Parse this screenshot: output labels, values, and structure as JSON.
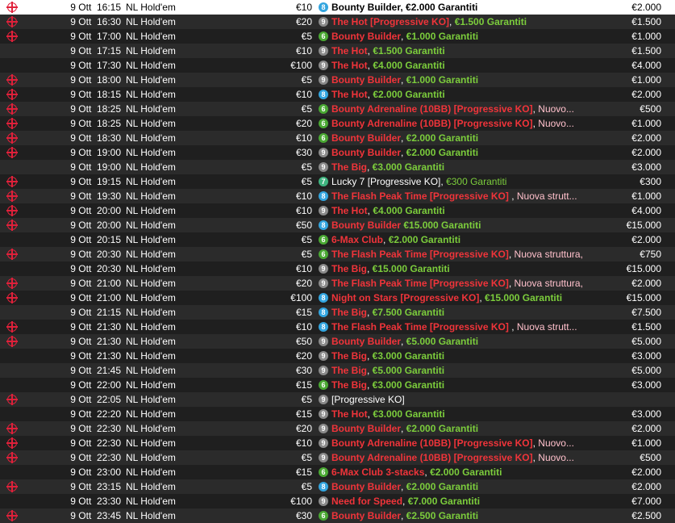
{
  "colors": {
    "badge_8": "#33a5df",
    "badge_9": "#8a8a8a",
    "badge_6": "#4aa833",
    "badge_7": "#3fb37f",
    "row_dark": "#2b2b2b",
    "row_darker": "#1f1f1f",
    "red_text": "#f0343a",
    "green_text": "#7ccd3c",
    "selected_row": "#ffffff"
  },
  "rows": [
    {
      "target": true,
      "date": "9 Ott",
      "time": "16:15",
      "game": "NL Hold'em",
      "buyin": "€10",
      "badge": "8",
      "parts": [
        {
          "t": "Bounty Builder, ",
          "c": "black-b"
        },
        {
          "t": "€2.000 Garantiti",
          "c": "black-b"
        }
      ],
      "prize": "€2.000",
      "selected": true
    },
    {
      "target": true,
      "date": "9 Ott",
      "time": "16:30",
      "game": "NL Hold'em",
      "buyin": "€20",
      "badge": "9",
      "parts": [
        {
          "t": "The Hot [Progressive KO]",
          "c": "red"
        },
        {
          "t": ", ",
          "c": "white"
        },
        {
          "t": "€1.500 Garantiti",
          "c": "green"
        }
      ],
      "prize": "€1.500"
    },
    {
      "target": true,
      "date": "9 Ott",
      "time": "17:00",
      "game": "NL Hold'em",
      "buyin": "€5",
      "badge": "6",
      "parts": [
        {
          "t": "Bounty Builder",
          "c": "red"
        },
        {
          "t": ", ",
          "c": "white"
        },
        {
          "t": "€1.000 Garantiti",
          "c": "green"
        }
      ],
      "prize": "€1.000"
    },
    {
      "target": false,
      "date": "9 Ott",
      "time": "17:15",
      "game": "NL Hold'em",
      "buyin": "€10",
      "badge": "9",
      "parts": [
        {
          "t": "The Hot",
          "c": "red"
        },
        {
          "t": ", ",
          "c": "white"
        },
        {
          "t": "€1.500 Garantiti",
          "c": "green"
        }
      ],
      "prize": "€1.500"
    },
    {
      "target": false,
      "date": "9 Ott",
      "time": "17:30",
      "game": "NL Hold'em",
      "buyin": "€100",
      "badge": "9",
      "parts": [
        {
          "t": "The Hot",
          "c": "red"
        },
        {
          "t": ", ",
          "c": "white"
        },
        {
          "t": "€4.000 Garantiti",
          "c": "green"
        }
      ],
      "prize": "€4.000"
    },
    {
      "target": true,
      "date": "9 Ott",
      "time": "18:00",
      "game": "NL Hold'em",
      "buyin": "€5",
      "badge": "9",
      "parts": [
        {
          "t": "Bounty Builder",
          "c": "red"
        },
        {
          "t": ", ",
          "c": "white"
        },
        {
          "t": "€1.000 Garantiti",
          "c": "green"
        }
      ],
      "prize": "€1.000"
    },
    {
      "target": true,
      "date": "9 Ott",
      "time": "18:15",
      "game": "NL Hold'em",
      "buyin": "€10",
      "badge": "8",
      "parts": [
        {
          "t": "The Hot",
          "c": "red"
        },
        {
          "t": ", ",
          "c": "white"
        },
        {
          "t": "€2.000 Garantiti",
          "c": "green"
        }
      ],
      "prize": "€2.000"
    },
    {
      "target": true,
      "date": "9 Ott",
      "time": "18:25",
      "game": "NL Hold'em",
      "buyin": "€5",
      "badge": "6",
      "parts": [
        {
          "t": "Bounty Adrenaline (10BB) [Progressive KO]",
          "c": "red"
        },
        {
          "t": ", ",
          "c": "white"
        },
        {
          "t": "Nuovo...",
          "c": "pink"
        }
      ],
      "prize": "€500"
    },
    {
      "target": true,
      "date": "9 Ott",
      "time": "18:25",
      "game": "NL Hold'em",
      "buyin": "€20",
      "badge": "6",
      "parts": [
        {
          "t": "Bounty Adrenaline (10BB) [Progressive KO]",
          "c": "red"
        },
        {
          "t": ", ",
          "c": "white"
        },
        {
          "t": "Nuovo...",
          "c": "pink"
        }
      ],
      "prize": "€1.000"
    },
    {
      "target": true,
      "date": "9 Ott",
      "time": "18:30",
      "game": "NL Hold'em",
      "buyin": "€10",
      "badge": "6",
      "parts": [
        {
          "t": "Bounty Builder",
          "c": "red"
        },
        {
          "t": ", ",
          "c": "white"
        },
        {
          "t": "€2.000 Garantiti",
          "c": "green"
        }
      ],
      "prize": "€2.000"
    },
    {
      "target": true,
      "date": "9 Ott",
      "time": "19:00",
      "game": "NL Hold'em",
      "buyin": "€30",
      "badge": "9",
      "parts": [
        {
          "t": "Bounty Builder",
          "c": "red"
        },
        {
          "t": ", ",
          "c": "white"
        },
        {
          "t": "€2.000 Garantiti",
          "c": "green"
        }
      ],
      "prize": "€2.000"
    },
    {
      "target": false,
      "date": "9 Ott",
      "time": "19:00",
      "game": "NL Hold'em",
      "buyin": "€5",
      "badge": "9",
      "parts": [
        {
          "t": "The Big",
          "c": "red"
        },
        {
          "t": ", ",
          "c": "white"
        },
        {
          "t": "€3.000 Garantiti",
          "c": "green"
        }
      ],
      "prize": "€3.000"
    },
    {
      "target": true,
      "date": "9 Ott",
      "time": "19:15",
      "game": "NL Hold'em",
      "buyin": "€5",
      "badge": "7",
      "parts": [
        {
          "t": "Lucky 7 [Progressive KO], ",
          "c": "white"
        },
        {
          "t": "€300 Garantiti",
          "c": "green-lite"
        }
      ],
      "prize": "€300"
    },
    {
      "target": true,
      "date": "9 Ott",
      "time": "19:30",
      "game": "NL Hold'em",
      "buyin": "€10",
      "badge": "8",
      "parts": [
        {
          "t": "The Flash Peak Time [Progressive KO]",
          "c": "red"
        },
        {
          "t": " , ",
          "c": "white"
        },
        {
          "t": "Nuova strutt...",
          "c": "pink"
        }
      ],
      "prize": "€1.000"
    },
    {
      "target": true,
      "date": "9 Ott",
      "time": "20:00",
      "game": "NL Hold'em",
      "buyin": "€10",
      "badge": "9",
      "parts": [
        {
          "t": "The Hot",
          "c": "red"
        },
        {
          "t": ", ",
          "c": "white"
        },
        {
          "t": "€4.000 Garantiti",
          "c": "green"
        }
      ],
      "prize": "€4.000"
    },
    {
      "target": true,
      "date": "9 Ott",
      "time": "20:00",
      "game": "NL Hold'em",
      "buyin": "€50",
      "badge": "8",
      "parts": [
        {
          "t": "Bounty Builder",
          "c": "red"
        },
        {
          "t": " ",
          "c": "white"
        },
        {
          "t": "€15.000 Garantiti",
          "c": "green"
        }
      ],
      "prize": "€15.000"
    },
    {
      "target": false,
      "date": "9 Ott",
      "time": "20:15",
      "game": "NL Hold'em",
      "buyin": "€5",
      "badge": "6",
      "parts": [
        {
          "t": "6-Max Club",
          "c": "red"
        },
        {
          "t": ", ",
          "c": "white"
        },
        {
          "t": "€2.000 Garantiti",
          "c": "green"
        }
      ],
      "prize": "€2.000"
    },
    {
      "target": true,
      "date": "9 Ott",
      "time": "20:30",
      "game": "NL Hold'em",
      "buyin": "€5",
      "badge": "6",
      "parts": [
        {
          "t": "The Flash Peak Time [Progressive KO]",
          "c": "red"
        },
        {
          "t": ", ",
          "c": "white"
        },
        {
          "t": "Nuova struttura,",
          "c": "pink"
        }
      ],
      "prize": "€750"
    },
    {
      "target": false,
      "date": "9 Ott",
      "time": "20:30",
      "game": "NL Hold'em",
      "buyin": "€10",
      "badge": "9",
      "parts": [
        {
          "t": "The Big",
          "c": "red"
        },
        {
          "t": ", ",
          "c": "white"
        },
        {
          "t": "€15.000 Garantiti",
          "c": "green"
        }
      ],
      "prize": "€15.000"
    },
    {
      "target": true,
      "date": "9 Ott",
      "time": "21:00",
      "game": "NL Hold'em",
      "buyin": "€20",
      "badge": "9",
      "parts": [
        {
          "t": "The Flash Peak Time [Progressive KO]",
          "c": "red"
        },
        {
          "t": ", ",
          "c": "white"
        },
        {
          "t": "Nuova struttura,",
          "c": "pink"
        }
      ],
      "prize": "€2.000"
    },
    {
      "target": true,
      "date": "9 Ott",
      "time": "21:00",
      "game": "NL Hold'em",
      "buyin": "€100",
      "badge": "8",
      "parts": [
        {
          "t": "Night on Stars [Progressive KO]",
          "c": "red"
        },
        {
          "t": ", ",
          "c": "white"
        },
        {
          "t": "€15.000 Garantiti",
          "c": "green"
        }
      ],
      "prize": "€15.000"
    },
    {
      "target": false,
      "date": "9 Ott",
      "time": "21:15",
      "game": "NL Hold'em",
      "buyin": "€15",
      "badge": "8",
      "parts": [
        {
          "t": "The Big",
          "c": "red"
        },
        {
          "t": ", ",
          "c": "white"
        },
        {
          "t": "€7.500 Garantiti",
          "c": "green"
        }
      ],
      "prize": "€7.500"
    },
    {
      "target": true,
      "date": "9 Ott",
      "time": "21:30",
      "game": "NL Hold'em",
      "buyin": "€10",
      "badge": "8",
      "parts": [
        {
          "t": "The Flash Peak Time [Progressive KO]",
          "c": "red"
        },
        {
          "t": " , ",
          "c": "white"
        },
        {
          "t": "Nuova strutt...",
          "c": "pink"
        }
      ],
      "prize": "€1.500"
    },
    {
      "target": true,
      "date": "9 Ott",
      "time": "21:30",
      "game": "NL Hold'em",
      "buyin": "€50",
      "badge": "9",
      "parts": [
        {
          "t": "Bounty Builder",
          "c": "red"
        },
        {
          "t": ", ",
          "c": "white"
        },
        {
          "t": "€5.000 Garantiti",
          "c": "green"
        }
      ],
      "prize": "€5.000"
    },
    {
      "target": false,
      "date": "9 Ott",
      "time": "21:30",
      "game": "NL Hold'em",
      "buyin": "€20",
      "badge": "9",
      "parts": [
        {
          "t": "The Big",
          "c": "red"
        },
        {
          "t": ", ",
          "c": "white"
        },
        {
          "t": "€3.000 Garantiti",
          "c": "green"
        }
      ],
      "prize": "€3.000"
    },
    {
      "target": false,
      "date": "9 Ott",
      "time": "21:45",
      "game": "NL Hold'em",
      "buyin": "€30",
      "badge": "9",
      "parts": [
        {
          "t": "The Big",
          "c": "red"
        },
        {
          "t": ", ",
          "c": "white"
        },
        {
          "t": "€5.000 Garantiti",
          "c": "green"
        }
      ],
      "prize": "€5.000"
    },
    {
      "target": false,
      "date": "9 Ott",
      "time": "22:00",
      "game": "NL Hold'em",
      "buyin": "€15",
      "badge": "6",
      "parts": [
        {
          "t": "The Big",
          "c": "red"
        },
        {
          "t": ", ",
          "c": "white"
        },
        {
          "t": "€3.000 Garantiti",
          "c": "green"
        }
      ],
      "prize": "€3.000"
    },
    {
      "target": true,
      "date": "9 Ott",
      "time": "22:05",
      "game": "NL Hold'em",
      "buyin": "€5",
      "badge": "9",
      "parts": [
        {
          "t": "[Progressive KO]",
          "c": "white"
        }
      ],
      "prize": ""
    },
    {
      "target": false,
      "date": "9 Ott",
      "time": "22:20",
      "game": "NL Hold'em",
      "buyin": "€15",
      "badge": "9",
      "parts": [
        {
          "t": "The Hot",
          "c": "red"
        },
        {
          "t": ", ",
          "c": "white"
        },
        {
          "t": "€3.000 Garantiti",
          "c": "green"
        }
      ],
      "prize": "€3.000"
    },
    {
      "target": true,
      "date": "9 Ott",
      "time": "22:30",
      "game": "NL Hold'em",
      "buyin": "€20",
      "badge": "9",
      "parts": [
        {
          "t": "Bounty Builder",
          "c": "red"
        },
        {
          "t": ", ",
          "c": "white"
        },
        {
          "t": "€2.000 Garantiti",
          "c": "green"
        }
      ],
      "prize": "€2.000"
    },
    {
      "target": true,
      "date": "9 Ott",
      "time": "22:30",
      "game": "NL Hold'em",
      "buyin": "€10",
      "badge": "9",
      "parts": [
        {
          "t": "Bounty Adrenaline (10BB) [Progressive KO]",
          "c": "red"
        },
        {
          "t": ", ",
          "c": "white"
        },
        {
          "t": "Nuovo...",
          "c": "pink"
        }
      ],
      "prize": "€1.000"
    },
    {
      "target": true,
      "date": "9 Ott",
      "time": "22:30",
      "game": "NL Hold'em",
      "buyin": "€5",
      "badge": "9",
      "parts": [
        {
          "t": "Bounty Adrenaline (10BB) [Progressive KO]",
          "c": "red"
        },
        {
          "t": ", ",
          "c": "white"
        },
        {
          "t": "Nuovo...",
          "c": "pink"
        }
      ],
      "prize": "€500"
    },
    {
      "target": false,
      "date": "9 Ott",
      "time": "23:00",
      "game": "NL Hold'em",
      "buyin": "€15",
      "badge": "6",
      "parts": [
        {
          "t": "6-Max Club 3-stacks",
          "c": "red"
        },
        {
          "t": ", ",
          "c": "white"
        },
        {
          "t": "€2.000 Garantiti",
          "c": "green"
        }
      ],
      "prize": "€2.000"
    },
    {
      "target": true,
      "date": "9 Ott",
      "time": "23:15",
      "game": "NL Hold'em",
      "buyin": "€5",
      "badge": "8",
      "parts": [
        {
          "t": "Bounty Builder",
          "c": "red"
        },
        {
          "t": ", ",
          "c": "white"
        },
        {
          "t": "€2.000 Garantiti",
          "c": "green"
        }
      ],
      "prize": "€2.000"
    },
    {
      "target": false,
      "date": "9 Ott",
      "time": "23:30",
      "game": "NL Hold'em",
      "buyin": "€100",
      "badge": "9",
      "parts": [
        {
          "t": "Need for Speed",
          "c": "red"
        },
        {
          "t": ", ",
          "c": "white"
        },
        {
          "t": "€7.000 Garantiti",
          "c": "green"
        }
      ],
      "prize": "€7.000"
    },
    {
      "target": true,
      "date": "9 Ott",
      "time": "23:45",
      "game": "NL Hold'em",
      "buyin": "€30",
      "badge": "6",
      "parts": [
        {
          "t": "Bounty Builder",
          "c": "red"
        },
        {
          "t": ", ",
          "c": "white"
        },
        {
          "t": "€2.500 Garantiti",
          "c": "green"
        }
      ],
      "prize": "€2.500"
    }
  ]
}
